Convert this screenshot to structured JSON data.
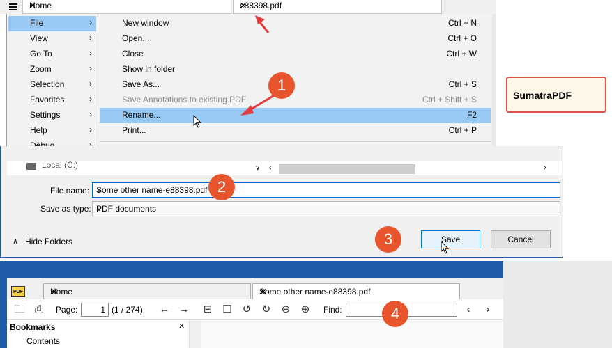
{
  "menu_panel": {
    "tabs": [
      {
        "label": "Home"
      },
      {
        "label": "e88398.pdf"
      }
    ],
    "submenu": [
      {
        "label": "File"
      },
      {
        "label": "View"
      },
      {
        "label": "Go To"
      },
      {
        "label": "Zoom"
      },
      {
        "label": "Selection"
      },
      {
        "label": "Favorites"
      },
      {
        "label": "Settings"
      },
      {
        "label": "Help"
      },
      {
        "label": "Debug"
      }
    ],
    "submenu_arrow": "›",
    "file_menu": [
      {
        "label": "New window",
        "shortcut": "Ctrl + N"
      },
      {
        "label": "Open...",
        "shortcut": "Ctrl + O"
      },
      {
        "label": "Close",
        "shortcut": "Ctrl + W"
      },
      {
        "label": "Show in folder",
        "shortcut": ""
      },
      {
        "label": "Save As...",
        "shortcut": "Ctrl + S"
      },
      {
        "label": "Save Annotations to existing PDF",
        "shortcut": "Ctrl + Shift + S"
      },
      {
        "label": "Rename...",
        "shortcut": "F2"
      },
      {
        "label": "Print...",
        "shortcut": "Ctrl + P"
      }
    ]
  },
  "callout_label": "SumatraPDF",
  "badges": [
    "1",
    "2",
    "3",
    "4"
  ],
  "save_dialog": {
    "drive_label": "Local (C:)",
    "file_name_label": "File name:",
    "file_name_value": "Some other name-e88398.pdf",
    "save_as_type_label": "Save as type:",
    "save_as_type_value": "PDF documents",
    "hide_folders_label": "Hide Folders",
    "save_button": "Save",
    "cancel_button": "Cancel"
  },
  "viewer": {
    "tabs": [
      {
        "label": "Home"
      },
      {
        "label": "Some other name-e88398.pdf"
      }
    ],
    "page_label": "Page:",
    "page_value": "1",
    "page_total": "(1 / 274)",
    "find_label": "Find:",
    "bookmarks_title": "Bookmarks",
    "bookmarks_first": "Contents"
  },
  "colors": {
    "accent": "#99c9f5",
    "badge": "#e8552d",
    "arrow": "#e03c3c",
    "titlebar_blue": "#1f5da8",
    "callout_border": "#d9534f"
  },
  "icons": [
    "hamburger-menu-icon",
    "close-icon",
    "chevron-right-icon",
    "chevron-down-icon",
    "chevron-up-icon",
    "drive-icon",
    "mouse-cursor-icon",
    "open-folder-icon",
    "print-icon",
    "arrow-left-icon",
    "arrow-right-icon",
    "fit-page-icon",
    "fit-width-icon",
    "rotate-left-icon",
    "rotate-right-icon",
    "zoom-out-icon",
    "zoom-in-icon",
    "sumatra-logo-icon"
  ]
}
